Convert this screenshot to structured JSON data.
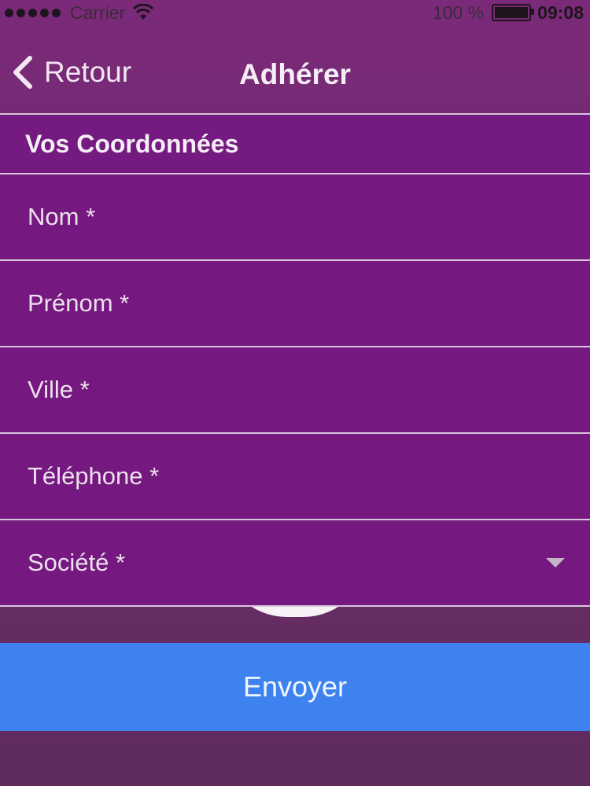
{
  "status_bar": {
    "carrier": "Carrier",
    "battery": "100 %",
    "time": "09:08"
  },
  "nav": {
    "back_label": "Retour",
    "title": "Adhérer"
  },
  "form": {
    "section_title": "Vos Coordonnées",
    "fields": [
      {
        "placeholder": "Nom *"
      },
      {
        "placeholder": "Prénom *"
      },
      {
        "placeholder": "Ville *"
      },
      {
        "placeholder": "Téléphone *"
      }
    ],
    "company_select": {
      "value": "Société *"
    }
  },
  "actions": {
    "send_label": "Envoyer"
  },
  "colors": {
    "background": "#6e2a6e",
    "form_row": "#75187f",
    "send_button": "#3d82ef"
  }
}
